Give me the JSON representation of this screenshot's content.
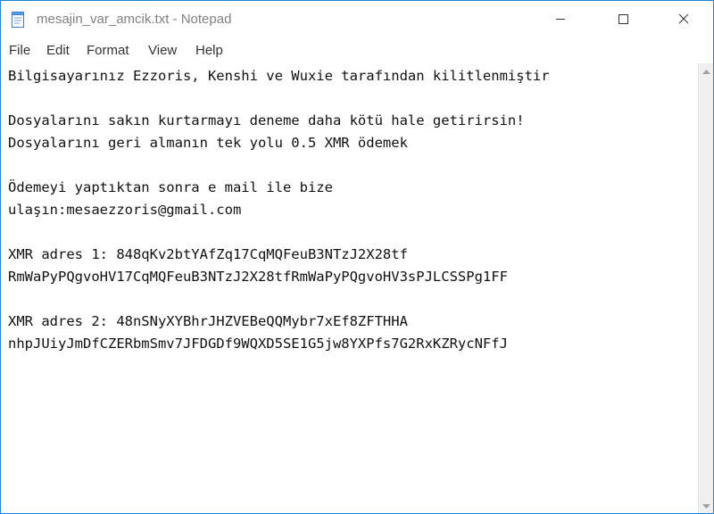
{
  "window": {
    "title": "mesajin_var_amcik.txt - Notepad",
    "app_icon": "notepad-icon",
    "controls": {
      "minimize": "minimize-icon",
      "maximize": "maximize-icon",
      "close": "close-icon"
    },
    "accent_color": "#1883d7"
  },
  "menu": {
    "file": "File",
    "edit": "Edit",
    "format": "Format",
    "view": "View",
    "help": "Help"
  },
  "document": {
    "lines": [
      "Bilgisayarınız Ezzoris, Kenshi ve Wuxie tarafından kilitlenmiştir",
      "",
      "Dosyalarını sakın kurtarmayı deneme daha kötü hale getirirsin!",
      "Dosyalarını geri almanın tek yolu 0.5 XMR ödemek",
      "",
      "Ödemeyi yaptıktan sonra e mail ile bize",
      "ulaşın:mesaezzoris@gmail.com",
      "",
      "XMR adres 1: 848qKv2btYAfZq17CqMQFeuB3NTzJ2X28tf",
      "RmWaPyPQgvoHV17CqMQFeuB3NTzJ2X28tfRmWaPyPQgvoHV3sPJLCSSPg1FF",
      "",
      "XMR adres 2: 48nSNyXYBhrJHZVEBeQQMybr7xEf8ZFTHHA",
      "nhpJUiyJmDfCZERbmSmv7JFDGDf9WQXD5SE1G5jw8YXPfs7G2RxKZRycNFfJ"
    ]
  },
  "scrollbar": {
    "up_icon": "scroll-up-icon",
    "down_icon": "scroll-down-icon"
  }
}
